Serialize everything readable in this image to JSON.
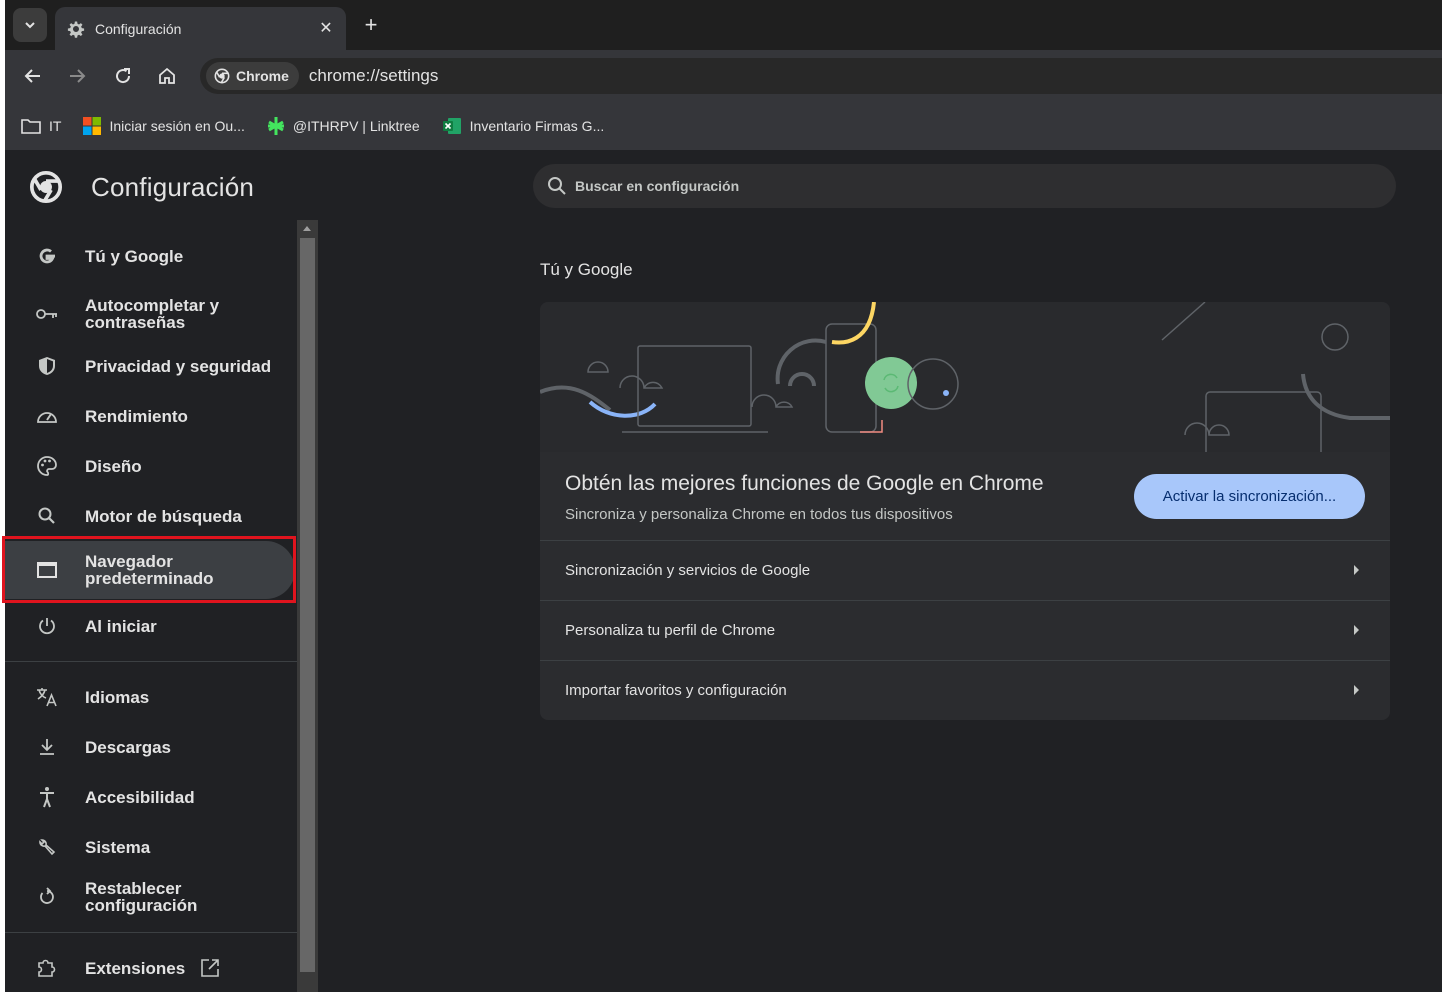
{
  "browser": {
    "tab": {
      "title": "Configuración",
      "close": "✕"
    },
    "new_tab": "+",
    "chip_label": "Chrome",
    "url": "chrome://settings",
    "bookmarks": [
      {
        "label": "IT",
        "icon": "folder-icon"
      },
      {
        "label": "Iniciar sesión en Ou...",
        "icon": "microsoft-icon"
      },
      {
        "label": "@ITHRPV | Linktree",
        "icon": "linktree-icon"
      },
      {
        "label": "Inventario Firmas G...",
        "icon": "excel-icon"
      }
    ]
  },
  "settings": {
    "title": "Configuración",
    "search_placeholder": "Buscar en configuración",
    "nav": [
      {
        "label": "Tú y Google",
        "icon": "google-g-icon"
      },
      {
        "label": "Autocompletar y contraseñas",
        "icon": "key-icon"
      },
      {
        "label": "Privacidad y seguridad",
        "icon": "shield-icon"
      },
      {
        "label": "Rendimiento",
        "icon": "speedometer-icon"
      },
      {
        "label": "Diseño",
        "icon": "palette-icon"
      },
      {
        "label": "Motor de búsqueda",
        "icon": "search-icon"
      },
      {
        "label": "Navegador predeterminado",
        "icon": "browser-window-icon",
        "selected": true
      },
      {
        "label": "Al iniciar",
        "icon": "power-icon"
      },
      {
        "label": "Idiomas",
        "icon": "translate-icon"
      },
      {
        "label": "Descargas",
        "icon": "download-icon"
      },
      {
        "label": "Accesibilidad",
        "icon": "accessibility-icon"
      },
      {
        "label": "Sistema",
        "icon": "wrench-icon"
      },
      {
        "label": "Restablecer configuración",
        "icon": "reset-icon"
      },
      {
        "label": "Extensiones",
        "icon": "puzzle-icon"
      }
    ],
    "section_title": "Tú y Google",
    "promo": {
      "heading": "Obtén las mejores funciones de Google en Chrome",
      "subtext": "Sincroniza y personaliza Chrome en todos tus dispositivos",
      "button": "Activar la sincronización..."
    },
    "rows": [
      {
        "label": "Sincronización y servicios de Google"
      },
      {
        "label": "Personaliza tu perfil de Chrome"
      },
      {
        "label": "Importar favoritos y configuración"
      }
    ]
  },
  "colors": {
    "accent": "#a8c7fa",
    "highlight_box": "#e0141e",
    "background": "#202124"
  }
}
